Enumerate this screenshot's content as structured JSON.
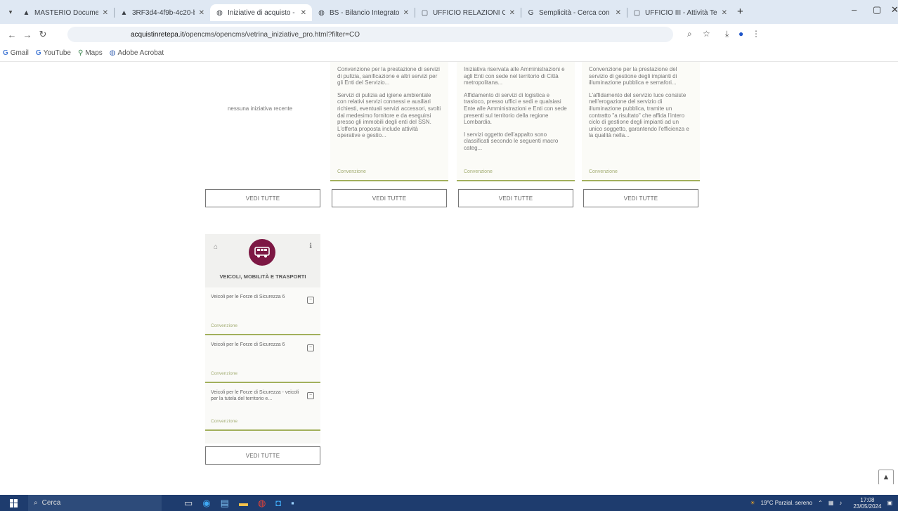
{
  "browser": {
    "tabs": [
      {
        "label": "MASTERIO Documenti prod",
        "icon": "drive-icon",
        "active": false
      },
      {
        "label": "3RF3d4-4f9b-4c20-bf21-8e2",
        "icon": "drive-icon",
        "active": false
      },
      {
        "label": "Iniziative di acquisto - acquisti",
        "icon": "globe-icon",
        "active": true
      },
      {
        "label": "BS - Bilancio Integrato Sociale",
        "icon": "globe-icon",
        "active": false
      },
      {
        "label": "UFFICIO RELAZIONI CON IL P",
        "icon": "page-icon",
        "active": false
      },
      {
        "label": "Semplicità - Cerca con Goog",
        "icon": "google-icon",
        "active": false
      },
      {
        "label": "UFFICIO III - Attività Territoriali",
        "icon": "page-icon",
        "active": false
      }
    ],
    "new_tab": "+",
    "url_domain": "acquistinretepa.it",
    "url_path": "/opencms/opencms/vetrina_iniziative_pro.html?filter=CO",
    "bookmarks": [
      {
        "label": "Gmail",
        "icon": "G"
      },
      {
        "label": "YouTube",
        "icon": "G"
      },
      {
        "label": "Maps",
        "icon": "pin"
      },
      {
        "label": "Adobe Acrobat",
        "icon": "globe"
      }
    ]
  },
  "first_column": {
    "note": "nessuna iniziativa recente",
    "see_all": "VEDI TUTTE"
  },
  "cards": [
    {
      "paragraphs": [
        "Convenzione per la prestazione di servizi di pulizia, sanificazione e altri servizi per gli Enti del Servizio...",
        "Servizi di pulizia ad igiene ambientale con relativi servizi connessi e ausiliari richiesti, eventuali servizi accessori, svolti dal medesimo fornitore e da eseguirsi presso gli immobili degli enti del SSN. L'offerta proposta include attività operative e gestio..."
      ],
      "link": "Convenzione",
      "see_all": "VEDI TUTTE"
    },
    {
      "paragraphs": [
        "Iniziativa riservata alle Amministrazioni e agli Enti con sede nel territorio di Città metropolitana...",
        "Affidamento di servizi di logistica e trasloco, presso uffici e sedi e qualsiasi Ente alle Amministrazioni e Enti con sede presenti sul territorio della regione Lombardia.",
        "I servizi oggetto dell'appalto sono classificati secondo le seguenti macro categ..."
      ],
      "link": "Convenzione",
      "see_all": "VEDI TUTTE"
    },
    {
      "paragraphs": [
        "Convenzione per la prestazione del servizio di gestione degli impianti di illuminazione pubblica e semafori...",
        "L'affidamento del servizio luce consiste nell'erogazione del servizio di illuminazione pubblica, tramite un contratto \"a risultato\" che affida l'intero ciclo di gestione degli impianti ad un unico soggetto, garantendo l'efficienza e la qualità nella..."
      ],
      "link": "Convenzione",
      "see_all": "VEDI TUTTE"
    }
  ],
  "category_card": {
    "title": "VEICOLI, MOBILITÀ E TRASPORTI",
    "items": [
      {
        "text": "Veicoli per le Forze di Sicurezza 6",
        "link": "Convenzione"
      },
      {
        "text": "Veicoli per le Forze di Sicurezza 6",
        "link": "Convenzione"
      },
      {
        "text": "Veicoli per le Forze di Sicurezza - veicoli per la tutela del territorio e...",
        "link": "Convenzione"
      }
    ],
    "see_all": "VEDI TUTTE"
  },
  "taskbar": {
    "search_placeholder": "Cerca",
    "weather": "19°C Parzial. sereno",
    "time": "17:08",
    "date": "23/05/2024"
  }
}
